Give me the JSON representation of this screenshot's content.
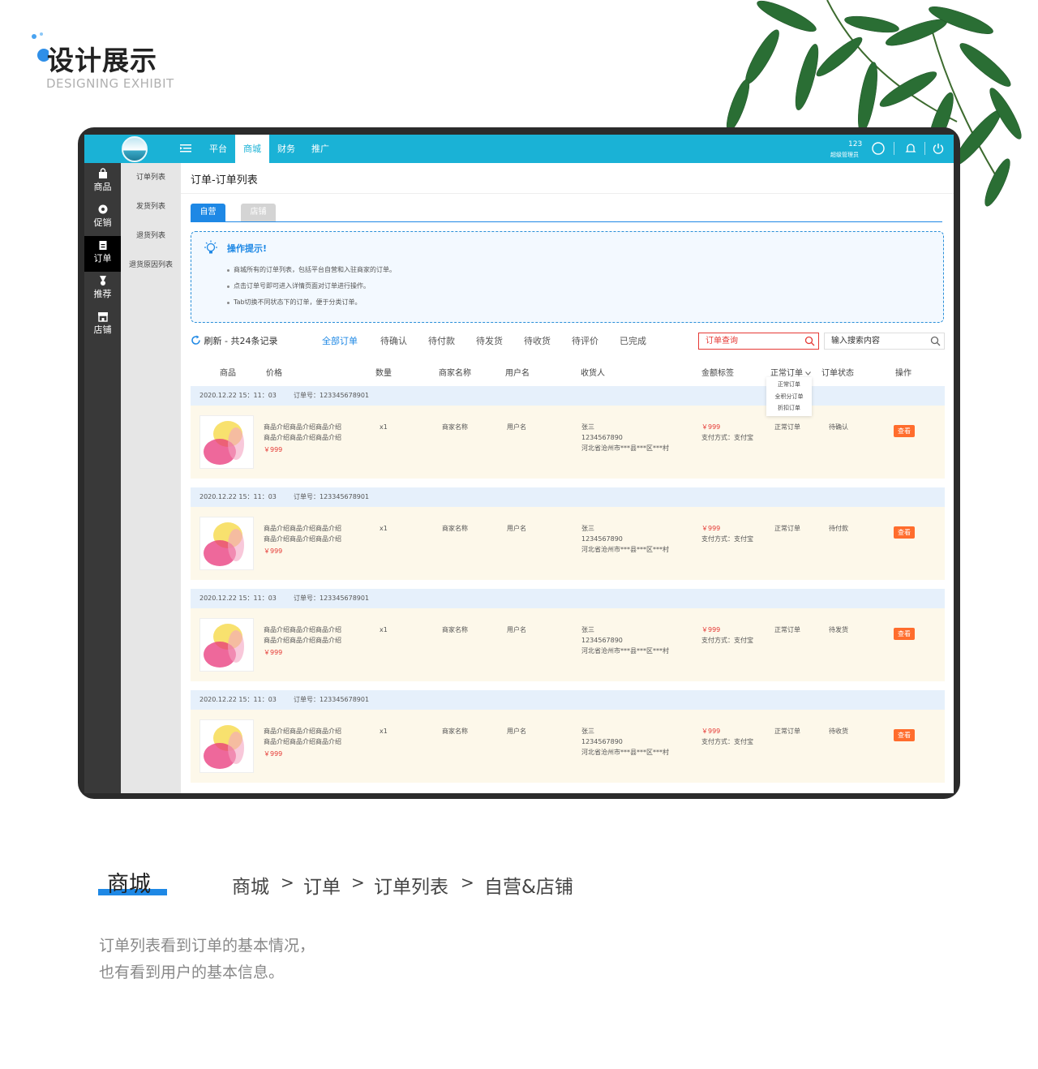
{
  "header": {
    "title": "设计展示",
    "subtitle": "DESIGNING EXHIBIT"
  },
  "topbar": {
    "nav": [
      "平台",
      "商城",
      "财务",
      "推广"
    ],
    "active_nav": "商城",
    "user_num": "123",
    "user_role": "超级管理员"
  },
  "sidebar": {
    "items": [
      "商品",
      "促销",
      "订单",
      "推荐",
      "店铺"
    ],
    "active": "订单"
  },
  "subsidebar": {
    "items": [
      "订单列表",
      "发货列表",
      "退货列表",
      "退货原因列表"
    ]
  },
  "content": {
    "title": "订单-订单列表",
    "tabs": [
      "自营",
      "店铺"
    ],
    "tips": {
      "title": "操作提示!",
      "lines": [
        "商城所有的订单列表，包括平台自营和入驻商家的订单。",
        "点击订单号即可进入详情页面对订单进行操作。",
        "Tab切换不同状态下的订单，便于分类订单。"
      ]
    },
    "refresh_label": "刷新 - 共24条记录",
    "filters": [
      "全部订单",
      "待确认",
      "待付款",
      "待发货",
      "待收货",
      "待评价",
      "已完成"
    ],
    "order_search_placeholder": "订单查询",
    "keyword_search_placeholder": "输入搜索内容",
    "columns": [
      "商品",
      "价格",
      "数量",
      "商家名称",
      "用户名",
      "收货人",
      "金额标签",
      "正常订单",
      "订单状态",
      "操作"
    ],
    "order_type_options": [
      "正常订单",
      "全积分订单",
      "折扣订单"
    ]
  },
  "orders": [
    {
      "time": "2020.12.22  15：11：03",
      "order_no": "订单号：123345678901",
      "desc1": "商品介绍商品介绍商品介绍",
      "desc2": "商品介绍商品介绍商品介绍",
      "price": "￥999",
      "qty": "x1",
      "merchant": "商家名称",
      "user": "用户名",
      "receiver": "张三",
      "phone": "1234567890",
      "address": "河北省沧州市***县***区***村",
      "amount": "￥999",
      "pay": "支付方式：支付宝",
      "type": "正常订单",
      "status": "待确认",
      "action": "查看"
    },
    {
      "time": "2020.12.22  15：11：03",
      "order_no": "订单号：123345678901",
      "desc1": "商品介绍商品介绍商品介绍",
      "desc2": "商品介绍商品介绍商品介绍",
      "price": "￥999",
      "qty": "x1",
      "merchant": "商家名称",
      "user": "用户名",
      "receiver": "张三",
      "phone": "1234567890",
      "address": "河北省沧州市***县***区***村",
      "amount": "￥999",
      "pay": "支付方式：支付宝",
      "type": "正常订单",
      "status": "待付款",
      "action": "查看"
    },
    {
      "time": "2020.12.22  15：11：03",
      "order_no": "订单号：123345678901",
      "desc1": "商品介绍商品介绍商品介绍",
      "desc2": "商品介绍商品介绍商品介绍",
      "price": "￥999",
      "qty": "x1",
      "merchant": "商家名称",
      "user": "用户名",
      "receiver": "张三",
      "phone": "1234567890",
      "address": "河北省沧州市***县***区***村",
      "amount": "￥999",
      "pay": "支付方式：支付宝",
      "type": "正常订单",
      "status": "待发货",
      "action": "查看"
    },
    {
      "time": "2020.12.22  15：11：03",
      "order_no": "订单号：123345678901",
      "desc1": "商品介绍商品介绍商品介绍",
      "desc2": "商品介绍商品介绍商品介绍",
      "price": "￥999",
      "qty": "x1",
      "merchant": "商家名称",
      "user": "用户名",
      "receiver": "张三",
      "phone": "1234567890",
      "address": "河北省沧州市***县***区***村",
      "amount": "￥999",
      "pay": "支付方式：支付宝",
      "type": "正常订单",
      "status": "待收货",
      "action": "查看"
    }
  ],
  "section": {
    "title": "商城",
    "breadcrumb": [
      "商城",
      "订单",
      "订单列表",
      "自营&店铺"
    ],
    "separator": ">",
    "desc": [
      "订单列表看到订单的基本情况，",
      "也有看到用户的基本信息。"
    ]
  },
  "colors": {
    "topbar": "#1ab2d6",
    "accent": "#1e88e5",
    "danger": "#e53935",
    "button": "#ff6d2d"
  }
}
